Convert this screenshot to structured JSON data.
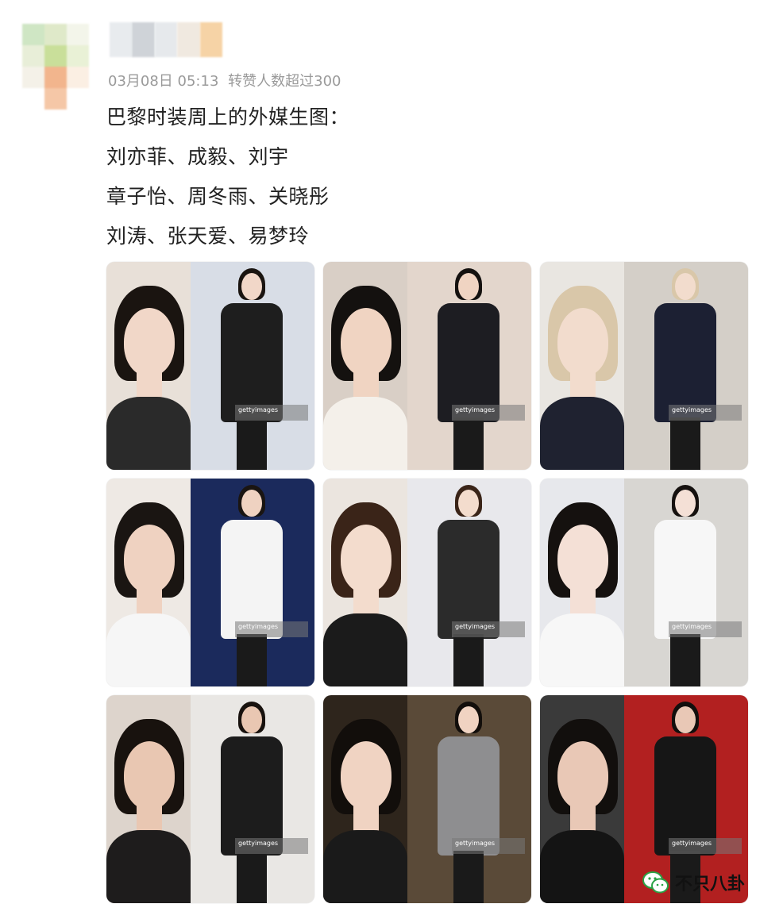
{
  "post": {
    "timestamp": "03月08日 05:13",
    "repost_note": "转赞人数超过300",
    "lines": [
      "巴黎时装周上的外媒生图：",
      "刘亦菲、成毅、刘宇",
      "章子怡、周冬雨、关晓彤",
      "刘涛、张天爱、易梦玲"
    ]
  },
  "photos": [
    {
      "bg_left": "#e8e0d8",
      "bg_right": "#d8dde6",
      "hair": "#1a1410",
      "skin": "#f1d7c8",
      "clothes": "#2a2a2a",
      "outfit": "#1e1e1e"
    },
    {
      "bg_left": "#d9cfc6",
      "bg_right": "#e3d6cc",
      "hair": "#14110f",
      "skin": "#f0d4c2",
      "clothes": "#f4f0ea",
      "outfit": "#1d1d22"
    },
    {
      "bg_left": "#e9e6e1",
      "bg_right": "#d4cfc8",
      "hair": "#d9c7a9",
      "skin": "#f2dccd",
      "clothes": "#1f2230",
      "outfit": "#1c2033"
    },
    {
      "bg_left": "#eee9e4",
      "bg_right": "#1b2a5c",
      "hair": "#1a1512",
      "skin": "#efd2c1",
      "clothes": "#f6f6f6",
      "outfit": "#f4f4f4"
    },
    {
      "bg_left": "#ebe5df",
      "bg_right": "#e8e8ec",
      "hair": "#3a2418",
      "skin": "#f3dccd",
      "clothes": "#1b1b1b",
      "outfit": "#2b2b2b"
    },
    {
      "bg_left": "#e7e8ec",
      "bg_right": "#d8d6d2",
      "hair": "#15110f",
      "skin": "#f4e0d6",
      "clothes": "#f7f7f7",
      "outfit": "#f7f7f7"
    },
    {
      "bg_left": "#ddd4cc",
      "bg_right": "#e9e7e4",
      "hair": "#18120e",
      "skin": "#e9c7b2",
      "clothes": "#1e1c1c",
      "outfit": "#1c1c1c"
    },
    {
      "bg_left": "#2e251c",
      "bg_right": "#5a4a38",
      "hair": "#120e0b",
      "skin": "#f0d3c2",
      "clothes": "#1a1a1a",
      "outfit": "#8e8e90"
    },
    {
      "bg_left": "#3a3a3a",
      "bg_right": "#b22020",
      "hair": "#120f0d",
      "skin": "#e9c8b6",
      "clothes": "#141414",
      "outfit": "#161616"
    }
  ],
  "watermark": "gettyimages",
  "brand": {
    "name": "不只八卦",
    "icon": "wechat-icon",
    "color": "#2ba245"
  },
  "avatar_colors": [
    "#cfe6c4",
    "#dfe9c9",
    "#f3f5ea",
    "#e8eed8",
    "#c9df9a",
    "#e9f1d6",
    "#f4f1e8",
    "#f2b58d",
    "#fbefe3",
    "#ffffff",
    "#f5c7a7",
    "#ffffff"
  ],
  "username_colors": [
    "#e8ebee",
    "#cfd3d8",
    "#e6e9ec",
    "#f0e9e0",
    "#f6d3a6"
  ]
}
